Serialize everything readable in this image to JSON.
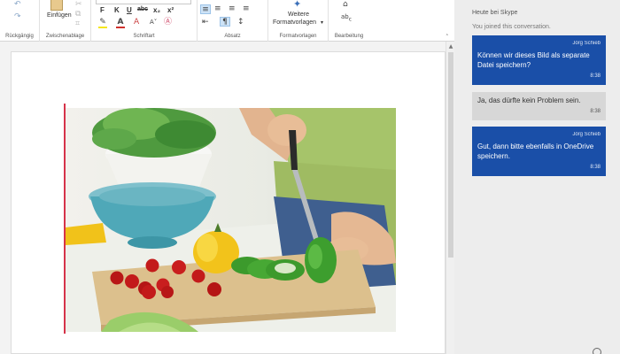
{
  "ribbon": {
    "groups": {
      "undo": "Rückgängig",
      "clipboard": "Zwischenablage",
      "font": "Schriftart",
      "paragraph": "Absatz",
      "styles": "Formatvorlagen",
      "editing": "Bearbeitung"
    },
    "paste_label": "Einfügen",
    "format_buttons": {
      "bold": "F",
      "italic": "K",
      "underline": "U",
      "strike": "abc",
      "subscript": "x₂",
      "superscript": "x²"
    },
    "styles_button": {
      "line1": "Weitere",
      "line2": "Formatvorlagen"
    }
  },
  "skype": {
    "title": "Heute bei Skype",
    "subtitle": "You joined this conversation.",
    "messages": [
      {
        "sender": "Jörg Schieb",
        "text": "Können wir dieses Bild als separate Datei speichern?",
        "time": "8:38"
      },
      {
        "sender": "",
        "text": "Ja, das dürfte kein Problem sein.",
        "time": "8:38"
      },
      {
        "sender": "Jörg Schieb",
        "text": "Gut, dann bitte ebenfalls in OneDrive speichern.",
        "time": "8:38"
      }
    ]
  },
  "colors": {
    "accent_blue": "#1a4fa8",
    "bubble_gray": "#d7d7d7",
    "cursor_red": "#d6334a",
    "pane_bg": "#ededed"
  },
  "icons": [
    "undo-icon",
    "redo-icon",
    "paste-icon",
    "cut-icon",
    "copy-icon",
    "format-painter-icon",
    "highlight-icon",
    "font-color-icon",
    "clear-format-icon",
    "align-left-icon",
    "align-center-icon",
    "align-right-icon",
    "justify-icon",
    "paragraph-direction-icon",
    "styles-icon",
    "find-icon",
    "replace-icon"
  ]
}
